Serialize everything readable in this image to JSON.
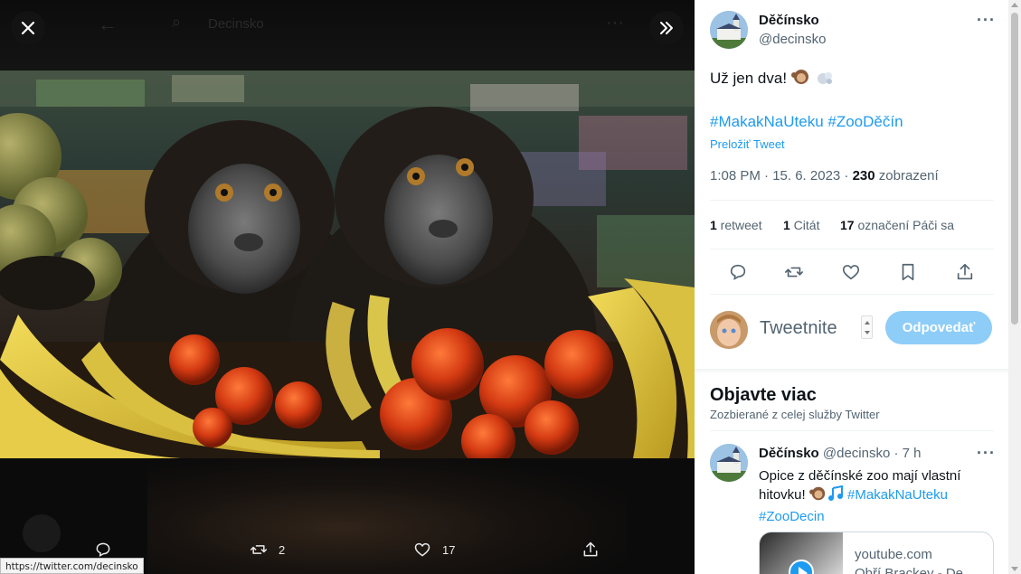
{
  "viewer": {
    "ghost_search_text": "Decinsko",
    "status_url": "https://twitter.com/decinsko",
    "actions": {
      "retweets": "2",
      "likes": "17"
    }
  },
  "tweet": {
    "author_name": "Děčínsko",
    "author_handle": "@decinsko",
    "text": "Už jen dva!",
    "hashtags": "#MakakNaUteku #ZooDěčín",
    "translate_label": "Preložiť Tweet",
    "time": "1:08 PM · 15. 6. 2023 · ",
    "views_count": "230",
    "views_label": " zobrazení",
    "stats": {
      "retweet_count": "1",
      "retweet_label": " retweet",
      "quote_count": "1",
      "quote_label": " Citát",
      "like_count": "17",
      "like_label": " označení Páči sa"
    }
  },
  "reply": {
    "placeholder": "Tweetnite",
    "button_label": "Odpovedať"
  },
  "discover": {
    "title": "Objavte viac",
    "subtitle": "Zozbierané z celej služby Twitter",
    "post": {
      "author_name": "Děčínsko",
      "author_handle": "@decinsko",
      "time": "· 7 h",
      "text_line1": "Opice z děčínské zoo mají vlastní",
      "text_line2_prefix": "hitovku!",
      "text_line2_tag": "#MakakNaUteku",
      "text_line3_tag": "#ZooDecin",
      "card_domain": "youtube.com",
      "card_title": "Obří Brackey - De..."
    }
  },
  "colors": {
    "accent": "#1d9bf0",
    "reply_button": "#8ecdf8"
  }
}
